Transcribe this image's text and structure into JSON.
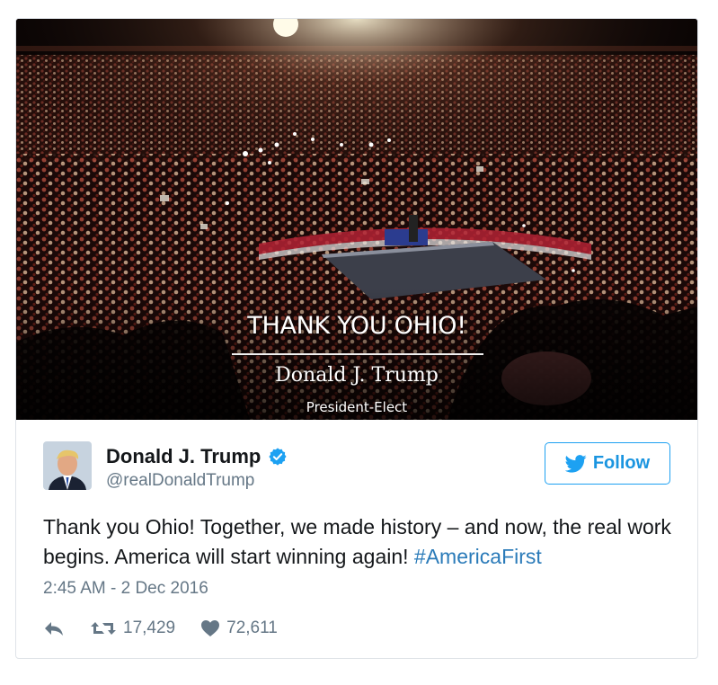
{
  "media": {
    "overlay_title": "THANK YOU OHIO!",
    "overlay_name": "Donald J. Trump",
    "overlay_role": "President-Elect"
  },
  "author": {
    "name": "Donald J. Trump",
    "handle": "@realDonaldTrump",
    "verified_icon": "verified-badge-icon"
  },
  "follow": {
    "label": "Follow",
    "icon": "twitter-bird-icon"
  },
  "tweet": {
    "text_before_hashtag": "Thank you Ohio! Together, we made history – and now, the real work begins. America will start winning again! ",
    "hashtag": "#AmericaFirst",
    "timestamp": "2:45 AM - 2 Dec 2016"
  },
  "actions": {
    "reply_icon": "reply-icon",
    "retweet_icon": "retweet-icon",
    "retweet_count": "17,429",
    "like_icon": "heart-icon",
    "like_count": "72,611"
  },
  "colors": {
    "accent": "#1da1f2",
    "hashtag": "#2b7bb9",
    "muted": "#657786",
    "text": "#14171a"
  }
}
